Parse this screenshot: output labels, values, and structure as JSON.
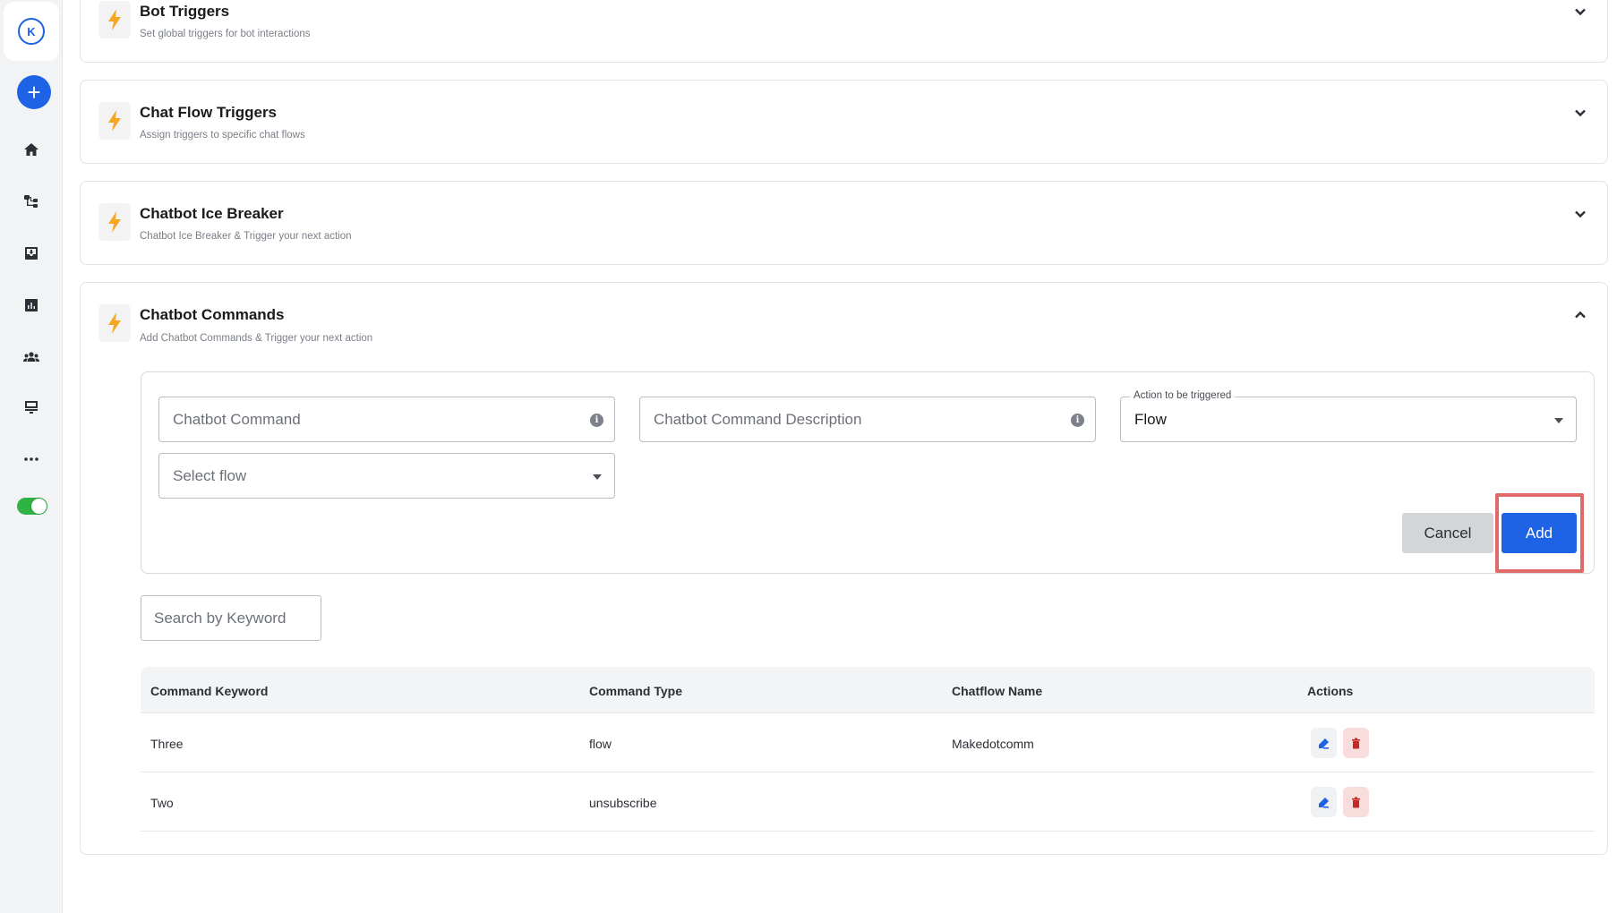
{
  "sidebar": {
    "items": [
      {
        "icon": "home-icon"
      },
      {
        "icon": "flow-icon"
      },
      {
        "icon": "inbox-icon"
      },
      {
        "icon": "reports-icon"
      },
      {
        "icon": "contacts-icon"
      },
      {
        "icon": "channels-icon"
      },
      {
        "icon": "more-icon"
      }
    ],
    "logo_text": "K"
  },
  "panels": [
    {
      "title": "Bot Triggers",
      "subtitle": "Set global triggers for bot interactions"
    },
    {
      "title": "Chat Flow Triggers",
      "subtitle": "Assign triggers to specific chat flows"
    },
    {
      "title": "Chatbot Ice Breaker",
      "subtitle": "Chatbot Ice Breaker & Trigger your next action"
    },
    {
      "title": "Chatbot Commands",
      "subtitle": "Add Chatbot Commands & Trigger your next action"
    }
  ],
  "form": {
    "command_placeholder": "Chatbot Command",
    "description_placeholder": "Chatbot Command Description",
    "action_label": "Action to be triggered",
    "action_value": "Flow",
    "flow_placeholder": "Select flow",
    "cancel_label": "Cancel",
    "add_label": "Add"
  },
  "search": {
    "placeholder": "Search by Keyword"
  },
  "table": {
    "headers": [
      "Command Keyword",
      "Command Type",
      "Chatflow Name",
      "Actions"
    ],
    "rows": [
      {
        "keyword": "Three",
        "type": "flow",
        "chatflow": "Makedotcomm"
      },
      {
        "keyword": "Two",
        "type": "unsubscribe",
        "chatflow": ""
      }
    ]
  },
  "colors": {
    "accent": "#1e63e6",
    "bolt": "#f5a623",
    "toggle_on": "#2fb344",
    "highlight": "#e06a6a"
  }
}
